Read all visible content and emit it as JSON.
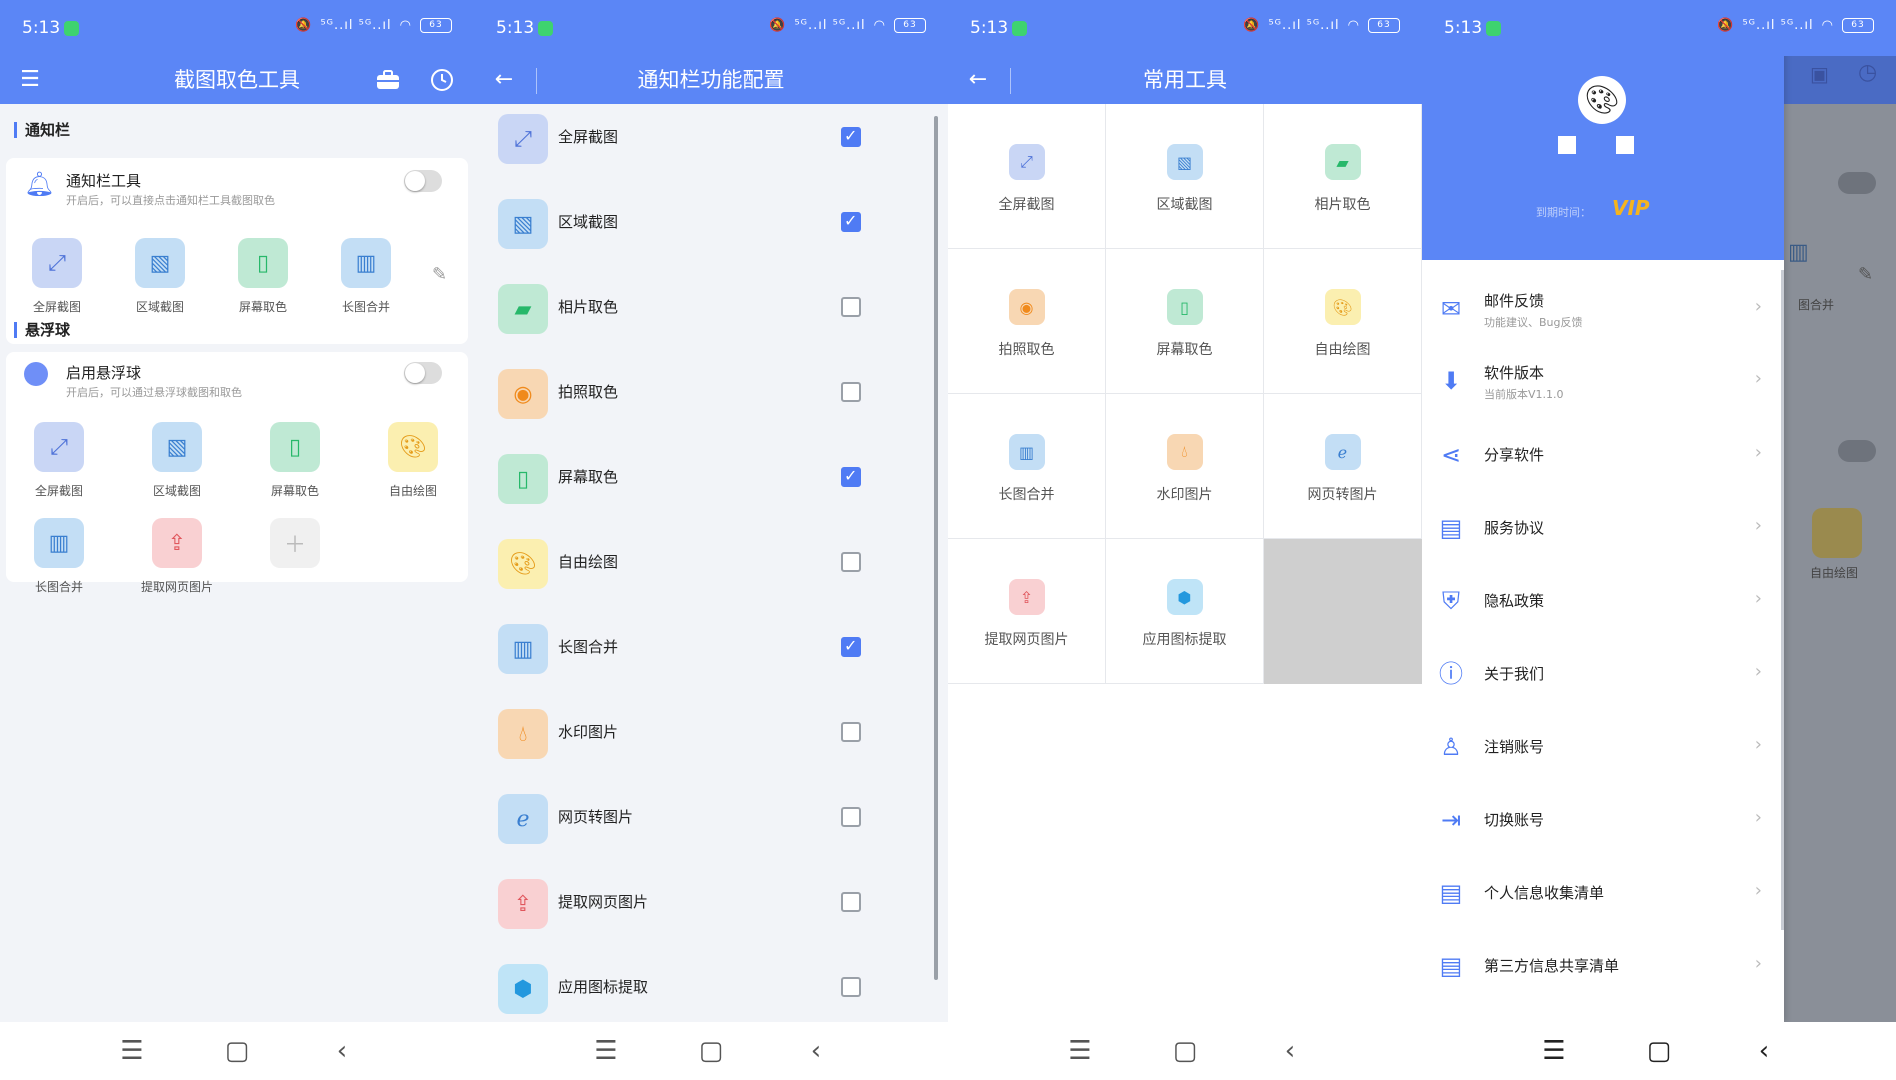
{
  "status": {
    "time": "5:13",
    "network": "⁵ᴳ..ıl ⁵ᴳ..ıl",
    "battery": "63"
  },
  "nav": {
    "menu": "☰",
    "home": "▢",
    "back": "‹"
  },
  "screen1": {
    "title": "截图取色工具",
    "notif_section": "通知栏",
    "notif_row_title": "通知栏工具",
    "notif_row_sub": "开启后，可以直接点击通知栏工具截图取色",
    "notif_tools": [
      "全屏截图",
      "区域截图",
      "屏幕取色",
      "长图合并"
    ],
    "float_section": "悬浮球",
    "float_row_title": "启用悬浮球",
    "float_row_sub": "开启后，可以通过悬浮球截图和取色",
    "float_tools": [
      "全屏截图",
      "区域截图",
      "屏幕取色",
      "自由绘图",
      "长图合并",
      "提取网页图片"
    ]
  },
  "screen2": {
    "title": "通知栏功能配置",
    "items": [
      {
        "label": "全屏截图",
        "checked": true
      },
      {
        "label": "区域截图",
        "checked": true
      },
      {
        "label": "相片取色",
        "checked": false
      },
      {
        "label": "拍照取色",
        "checked": false
      },
      {
        "label": "屏幕取色",
        "checked": true
      },
      {
        "label": "自由绘图",
        "checked": false
      },
      {
        "label": "长图合并",
        "checked": true
      },
      {
        "label": "水印图片",
        "checked": false
      },
      {
        "label": "网页转图片",
        "checked": false
      },
      {
        "label": "提取网页图片",
        "checked": false
      },
      {
        "label": "应用图标提取",
        "checked": false
      }
    ]
  },
  "screen3": {
    "title": "常用工具",
    "tools": [
      "全屏截图",
      "区域截图",
      "相片取色",
      "拍照取色",
      "屏幕取色",
      "自由绘图",
      "长图合并",
      "水印图片",
      "网页转图片",
      "提取网页图片",
      "应用图标提取"
    ]
  },
  "screen4": {
    "expire_label": "到期时间：",
    "vip": "VIP",
    "menu": [
      {
        "title": "邮件反馈",
        "sub": "功能建议、Bug反馈"
      },
      {
        "title": "软件版本",
        "sub": "当前版本V1.1.0"
      },
      {
        "title": "分享软件",
        "sub": ""
      },
      {
        "title": "服务协议",
        "sub": ""
      },
      {
        "title": "隐私政策",
        "sub": ""
      },
      {
        "title": "关于我们",
        "sub": ""
      },
      {
        "title": "注销账号",
        "sub": ""
      },
      {
        "title": "切换账号",
        "sub": ""
      },
      {
        "title": "个人信息收集清单",
        "sub": ""
      },
      {
        "title": "第三方信息共享清单",
        "sub": ""
      }
    ],
    "behind_label_1": "图合并",
    "behind_label_2": "自由绘图"
  },
  "colors": {
    "primary": "#5b86f6",
    "accent": "#4f7bf4",
    "page_bg": "#f2f4f8",
    "dim": "#8a8f98"
  }
}
